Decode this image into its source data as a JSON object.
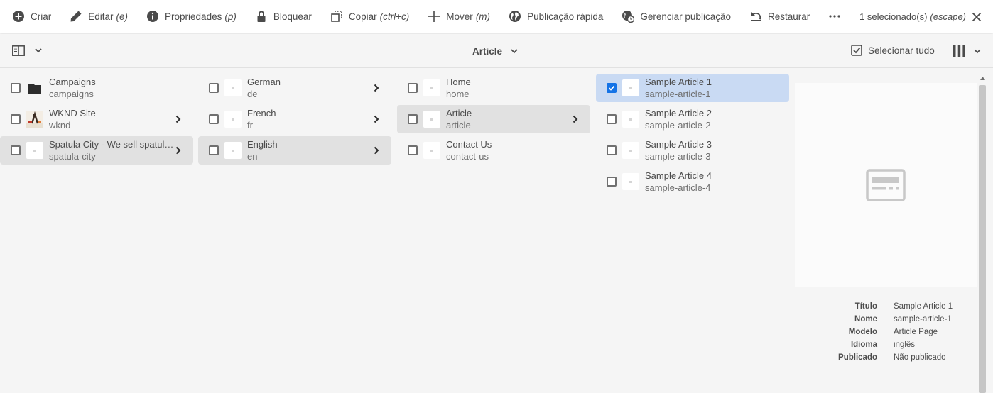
{
  "actionbar": {
    "actions": [
      {
        "label": "Criar",
        "shortcut": "",
        "icon": "add-circle-icon"
      },
      {
        "label": "Editar",
        "shortcut": "(e)",
        "icon": "pencil-icon"
      },
      {
        "label": "Propriedades",
        "shortcut": "(p)",
        "icon": "info-icon"
      },
      {
        "label": "Bloquear",
        "shortcut": "",
        "icon": "lock-icon"
      },
      {
        "label": "Copiar",
        "shortcut": "(ctrl+c)",
        "icon": "copy-icon"
      },
      {
        "label": "Mover",
        "shortcut": "(m)",
        "icon": "move-icon"
      },
      {
        "label": "Publicação rápida",
        "shortcut": "",
        "icon": "globe-icon"
      },
      {
        "label": "Gerenciar publicação",
        "shortcut": "",
        "icon": "globe-clock-icon"
      },
      {
        "label": "Restaurar",
        "shortcut": "",
        "icon": "undo-icon"
      }
    ],
    "selection": {
      "label": "1 selecionado(s)",
      "shortcut": "(escape)"
    }
  },
  "subbar": {
    "title": "Article",
    "select_all": "Selecionar tudo"
  },
  "columns": [
    {
      "items": [
        {
          "title": "Campaigns",
          "name": "campaigns",
          "thumb": "folder",
          "has_children": false,
          "state": "normal"
        },
        {
          "title": "WKND Site",
          "name": "wknd",
          "thumb": "site",
          "has_children": true,
          "state": "normal"
        },
        {
          "title": "Spatula City - We sell spatulas...",
          "name": "spatula-city",
          "thumb": "page",
          "has_children": true,
          "state": "active"
        }
      ]
    },
    {
      "items": [
        {
          "title": "German",
          "name": "de",
          "thumb": "page",
          "has_children": true,
          "state": "normal"
        },
        {
          "title": "French",
          "name": "fr",
          "thumb": "page",
          "has_children": true,
          "state": "normal"
        },
        {
          "title": "English",
          "name": "en",
          "thumb": "page",
          "has_children": true,
          "state": "active"
        }
      ]
    },
    {
      "items": [
        {
          "title": "Home",
          "name": "home",
          "thumb": "page",
          "has_children": false,
          "state": "normal"
        },
        {
          "title": "Article",
          "name": "article",
          "thumb": "page",
          "has_children": true,
          "state": "active"
        },
        {
          "title": "Contact Us",
          "name": "contact-us",
          "thumb": "page",
          "has_children": false,
          "state": "normal"
        }
      ]
    },
    {
      "items": [
        {
          "title": "Sample Article 1",
          "name": "sample-article-1",
          "thumb": "page",
          "has_children": false,
          "state": "selected"
        },
        {
          "title": "Sample Article 2",
          "name": "sample-article-2",
          "thumb": "page",
          "has_children": false,
          "state": "normal"
        },
        {
          "title": "Sample Article 3",
          "name": "sample-article-3",
          "thumb": "page",
          "has_children": false,
          "state": "normal"
        },
        {
          "title": "Sample Article 4",
          "name": "sample-article-4",
          "thumb": "page",
          "has_children": false,
          "state": "normal"
        }
      ]
    }
  ],
  "preview": {
    "meta": [
      {
        "label": "Título",
        "value": "Sample Article 1"
      },
      {
        "label": "Nome",
        "value": "sample-article-1"
      },
      {
        "label": "Modelo",
        "value": "Article Page"
      },
      {
        "label": "Idioma",
        "value": "inglês"
      },
      {
        "label": "Publicado",
        "value": "Não publicado"
      }
    ]
  },
  "colors": {
    "selected_bg": "#c9daf3",
    "active_bg": "#e1e1e1",
    "checkbox_accent": "#1473e6"
  }
}
